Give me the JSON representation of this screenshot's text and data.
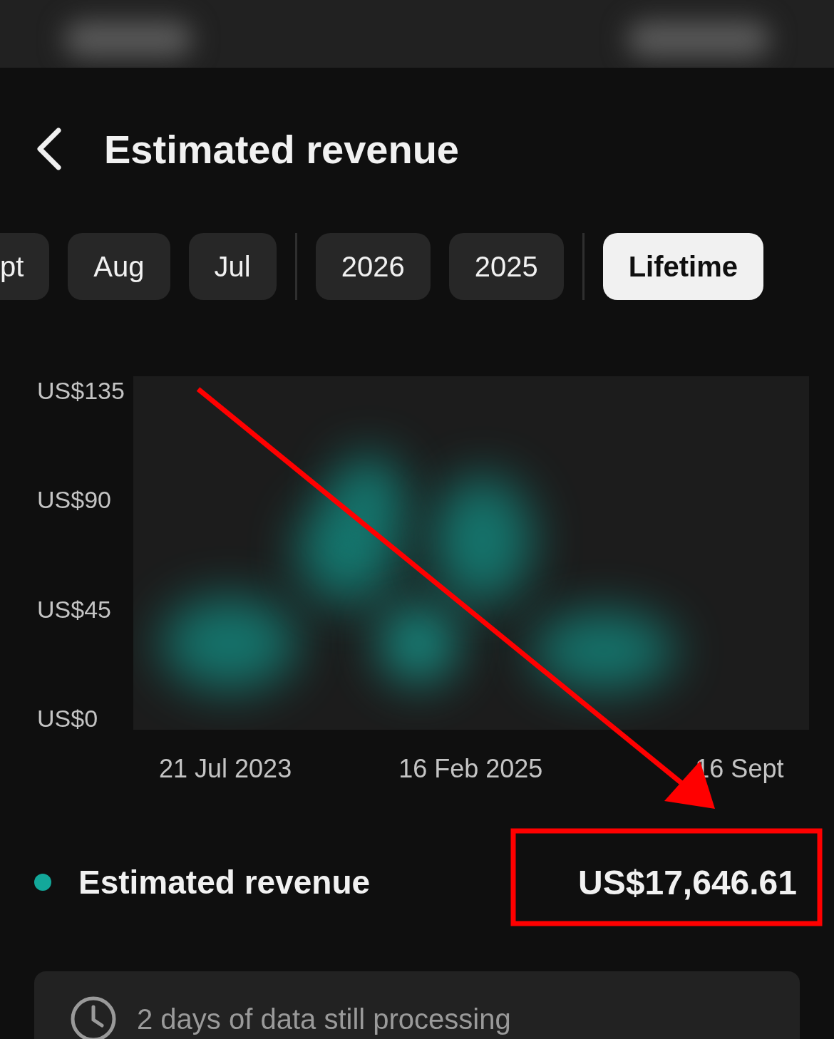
{
  "header": {
    "title": "Estimated revenue"
  },
  "chip_groups": [
    [
      {
        "label": "pt",
        "selected": false
      },
      {
        "label": "Aug",
        "selected": false
      },
      {
        "label": "Jul",
        "selected": false
      }
    ],
    [
      {
        "label": "2026",
        "selected": false
      },
      {
        "label": "2025",
        "selected": false
      }
    ],
    [
      {
        "label": "Lifetime",
        "selected": true
      }
    ]
  ],
  "chart": {
    "y_labels": [
      "US$135",
      "US$90",
      "US$45",
      "US$0"
    ],
    "x_labels": [
      "21 Jul 2023",
      "16 Feb 2025",
      "16 Sept"
    ]
  },
  "legend": {
    "label": "Estimated revenue",
    "color": "#13a89a",
    "value": "US$17,646.61"
  },
  "notice": {
    "text": "2 days of data still processing"
  }
}
